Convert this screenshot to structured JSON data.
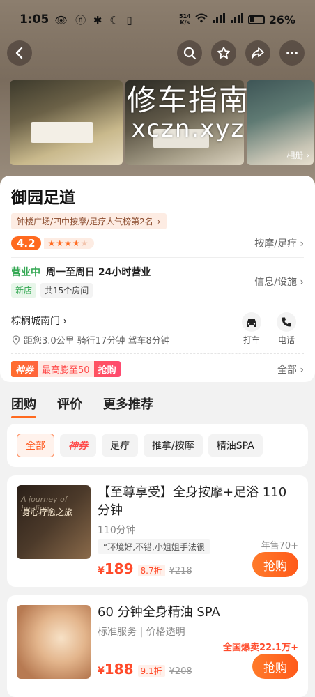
{
  "status_bar": {
    "time": "1:05",
    "net_speed_top": "514",
    "net_speed_bottom": "K/s",
    "battery": "26%"
  },
  "header": {
    "back_icon": "back-arrow-icon",
    "search_icon": "search-icon",
    "favorite_icon": "star-icon",
    "share_icon": "share-icon",
    "more_icon": "more-dots-icon"
  },
  "gallery": {
    "album_label": "相册 ›"
  },
  "watermark": {
    "line1": "修车指南",
    "line2": "xczn.xyz"
  },
  "shop": {
    "name": "御园足道",
    "rank": "钟楼广场/四中按摩/足疗人气榜第2名",
    "score": "4.2",
    "stars": "★★★★",
    "star_dim": "★",
    "category_link": "按摩/足疗 ›",
    "open_status": "营业中",
    "hours": "周一至周日 24小时营业",
    "tag_new": "新店",
    "tag_rooms": "共15个房间",
    "info_link": "信息/设施 ›",
    "address": "棕榈城南门 ›",
    "distance": "距您3.0公里 骑行17分钟 驾车8分钟",
    "taxi_label": "打车",
    "phone_label": "电话",
    "coupon_brand": "神券",
    "coupon_text": "最高膨至50",
    "coupon_action": "抢购",
    "coupon_all": "全部 ›"
  },
  "tabs": [
    "团购",
    "评价",
    "更多推荐"
  ],
  "filters": [
    "全部",
    "神券",
    "足疗",
    "推拿/按摩",
    "精油SPA"
  ],
  "deals": [
    {
      "thumb_text_en": "A journey of healing",
      "thumb_text": "身心疗愈之旅",
      "title": "【至尊享受】全身按摩+足浴 110分钟",
      "subtitle": "110分钟",
      "review": "“环境好,不错,小姐姐手法很",
      "price_symbol": "¥",
      "price": "189",
      "discount": "8.7折",
      "original": "¥218",
      "sales": "年售70+",
      "buy": "抢购"
    },
    {
      "title": "60 分钟全身精油 SPA",
      "subtitle": "标准服务 | 价格透明",
      "price_symbol": "¥",
      "price": "188",
      "discount": "9.1折",
      "original": "¥208",
      "sales": "全国爆卖22.1万+",
      "buy": "抢购"
    }
  ]
}
